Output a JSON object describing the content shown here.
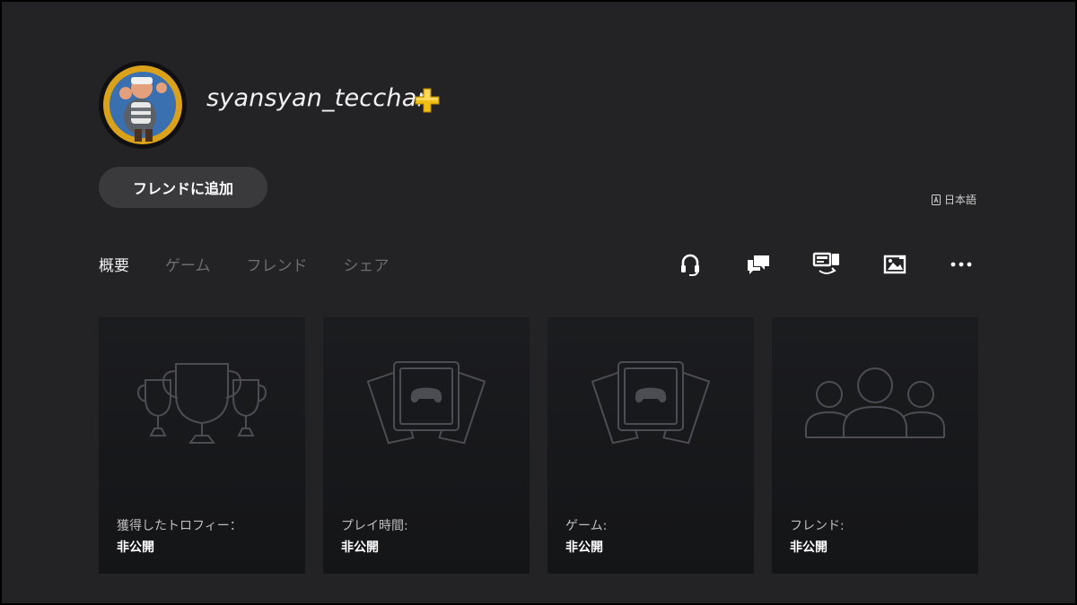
{
  "profile": {
    "username": "syansyan_tecchan",
    "add_friend_label": "フレンドに追加",
    "language": "日本語",
    "plus_color": "#f2c014"
  },
  "tabs": [
    {
      "label": "概要",
      "active": true
    },
    {
      "label": "ゲーム",
      "active": false
    },
    {
      "label": "フレンド",
      "active": false
    },
    {
      "label": "シェア",
      "active": false
    }
  ],
  "actions": [
    {
      "icon": "headset-icon"
    },
    {
      "icon": "message-icon"
    },
    {
      "icon": "remote-play-icon"
    },
    {
      "icon": "share-screen-icon"
    },
    {
      "icon": "more-options-icon"
    }
  ],
  "cards": [
    {
      "icon": "trophies-icon",
      "label": "獲得したトロフィー：",
      "value": "非公開"
    },
    {
      "icon": "games-icon",
      "label": "プレイ時間:",
      "value": "非公開"
    },
    {
      "icon": "games-icon",
      "label": "ゲーム:",
      "value": "非公開"
    },
    {
      "icon": "friends-icon",
      "label": "フレンド:",
      "value": "非公開"
    }
  ]
}
